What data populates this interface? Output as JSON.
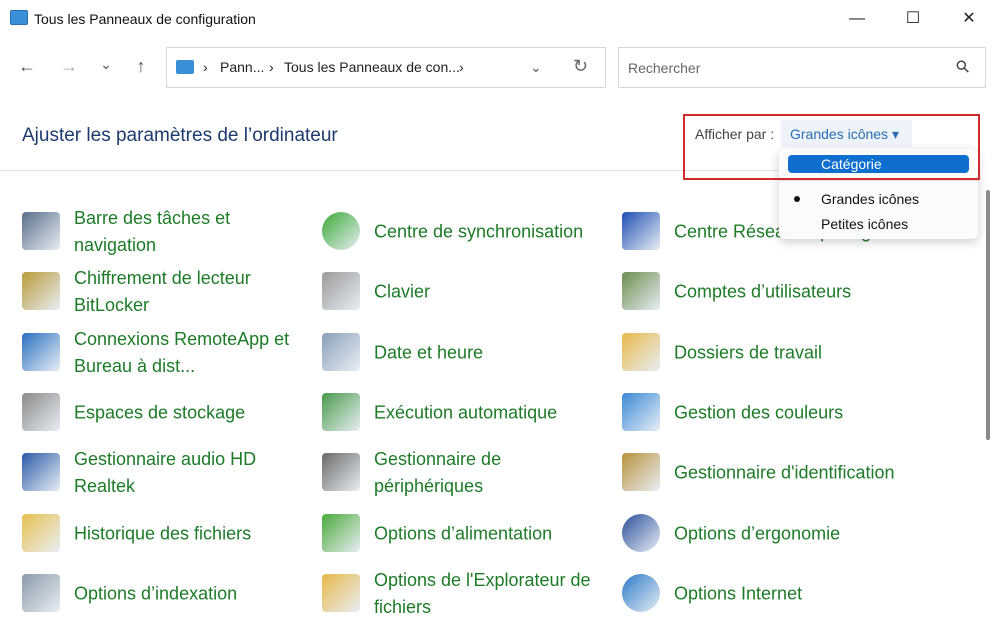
{
  "window": {
    "title": "Tous les Panneaux de configuration",
    "minimize": "—",
    "maximize": "☐",
    "close": "✕"
  },
  "nav": {
    "back": "←",
    "forward": "→",
    "recent": "⌄",
    "up": "↑"
  },
  "address": {
    "crumbs": [
      "Pann...",
      "Tous les Panneaux de con..."
    ],
    "separator": "›",
    "dropdown": "⌄",
    "refresh": "↻"
  },
  "search": {
    "placeholder": "Rechercher",
    "icon": "⚲"
  },
  "heading": "Ajuster les paramètres de l’ordinateur",
  "view": {
    "label": "Afficher par :",
    "selected": "Grandes icônes ▾",
    "options": [
      "Catégorie",
      "Grandes icônes",
      "Petites icônes"
    ],
    "highlighted": "Catégorie",
    "checked": "Grandes icônes"
  },
  "items": [
    {
      "label": "Barre des tâches et navigation",
      "icon": "taskbar-icon",
      "color": "#5a6f8a"
    },
    {
      "label": "Centre de synchronisation",
      "icon": "sync-icon",
      "color": "#3aa935"
    },
    {
      "label": "Centre Réseau et partage",
      "icon": "network-icon",
      "color": "#1f4fb5"
    },
    {
      "label": "Chiffrement de lecteur BitLocker",
      "icon": "bitlocker-icon",
      "color": "#b89b3a"
    },
    {
      "label": "Clavier",
      "icon": "keyboard-icon",
      "color": "#9a9a9a"
    },
    {
      "label": "Comptes d’utilisateurs",
      "icon": "users-icon",
      "color": "#6b8e4e"
    },
    {
      "label": "Connexions RemoteApp et Bureau à dist...",
      "icon": "remoteapp-icon",
      "color": "#2a6fc0"
    },
    {
      "label": "Date et heure",
      "icon": "clock-icon",
      "color": "#8aa0b8"
    },
    {
      "label": "Dossiers de travail",
      "icon": "work-folders-icon",
      "color": "#e8b84a"
    },
    {
      "label": "Espaces de stockage",
      "icon": "storage-icon",
      "color": "#8a8a8a"
    },
    {
      "label": "Exécution automatique",
      "icon": "autoplay-icon",
      "color": "#4a9a4a"
    },
    {
      "label": "Gestion des couleurs",
      "icon": "color-management-icon",
      "color": "#3a8ad6"
    },
    {
      "label": "Gestionnaire audio HD Realtek",
      "icon": "audio-icon",
      "color": "#2a5aa8"
    },
    {
      "label": "Gestionnaire de périphériques",
      "icon": "device-manager-icon",
      "color": "#6a6a6a"
    },
    {
      "label": "Gestionnaire d'identification",
      "icon": "credential-icon",
      "color": "#b8923a"
    },
    {
      "label": "Historique des fichiers",
      "icon": "file-history-icon",
      "color": "#e8c050"
    },
    {
      "label": "Options d’alimentation",
      "icon": "power-icon",
      "color": "#4aaa3a"
    },
    {
      "label": "Options d’ergonomie",
      "icon": "ease-of-access-icon",
      "color": "#2a4f9a"
    },
    {
      "label": "Options d’indexation",
      "icon": "indexing-icon",
      "color": "#8a9aaa"
    },
    {
      "label": "Options de l'Explorateur de fichiers",
      "icon": "folder-options-icon",
      "color": "#e8b84a"
    },
    {
      "label": "Options Internet",
      "icon": "internet-icon",
      "color": "#2a7ac8"
    }
  ]
}
